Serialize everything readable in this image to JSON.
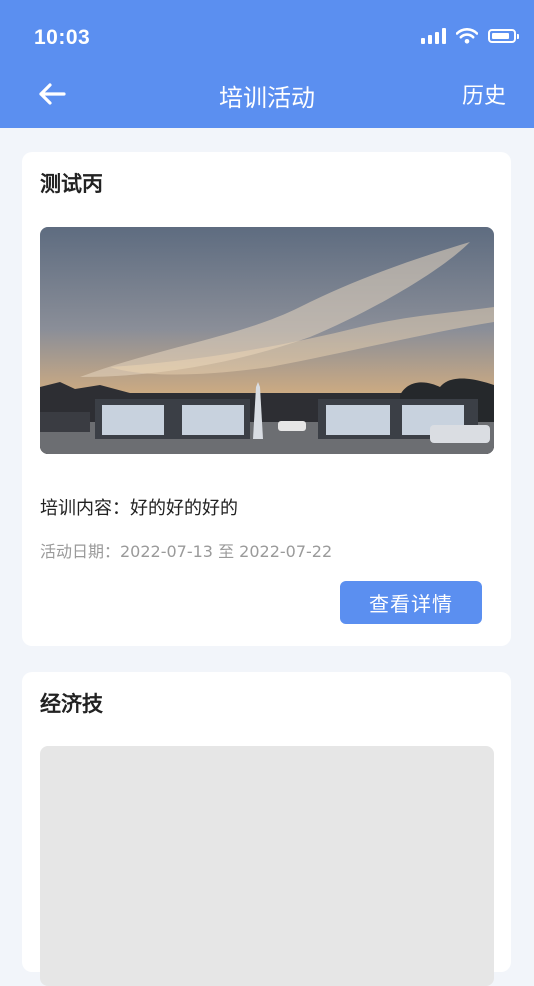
{
  "status_bar": {
    "time": "10:03",
    "battery_level": 0.85
  },
  "nav": {
    "title": "培训活动",
    "right_label": "历史",
    "back_icon": "arrow-left-icon"
  },
  "colors": {
    "primary": "#5B8FF0",
    "background": "#F2F5FA"
  },
  "cards": [
    {
      "title": "测试丙",
      "content": "培训内容：好的好的好的",
      "date": "活动日期：2022-07-13 至 2022-07-22",
      "button_label": "查看详情"
    },
    {
      "title": "经济技"
    }
  ]
}
